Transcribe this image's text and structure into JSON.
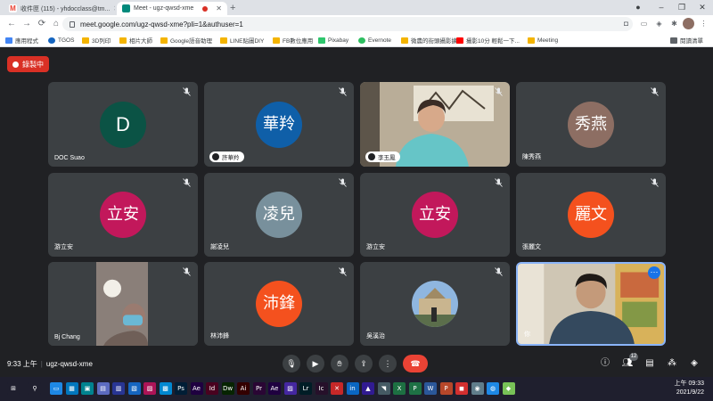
{
  "browser": {
    "tabs": [
      {
        "title": "收件匣 (115) - yhdocclass@tm...",
        "favicon_color": "#ea4335",
        "favicon_text": "M"
      },
      {
        "title": "Meet - ugz-qwsd-xme",
        "favicon_color": "#00897b",
        "favicon_text": ""
      }
    ],
    "url": "meet.google.com/ugz-qwsd-xme?pli=1&authuser=1",
    "bookmarks": [
      {
        "label": "應用程式",
        "icon_color": "#4285f4"
      },
      {
        "label": "TGOS",
        "icon_color": "#1565c0"
      },
      {
        "label": "3D列印",
        "icon_color": "#f4b400"
      },
      {
        "label": "相片大師",
        "icon_color": "#f4b400"
      },
      {
        "label": "Google語音助理",
        "icon_color": "#f4b400"
      },
      {
        "label": "LINE貼圖DIY",
        "icon_color": "#f4b400"
      },
      {
        "label": "FB數位應用",
        "icon_color": "#f4b400"
      },
      {
        "label": "Pixabay",
        "icon_color": "#2ec66d"
      },
      {
        "label": "Evernote",
        "icon_color": "#2dbe60"
      },
      {
        "label": "微農的街頭攝影擴",
        "icon_color": "#f4b400"
      },
      {
        "label": "攝影10分 輕鬆一下...",
        "icon_color": "#ff0000"
      },
      {
        "label": "Meeting",
        "icon_color": "#f4b400"
      }
    ],
    "reading_list": "閱讀清單"
  },
  "meet": {
    "recording_label": "錄製中",
    "meeting_time": "9:33 上午",
    "meeting_code": "ugz-qwsd-xme",
    "participant_count": "12",
    "tiles": [
      {
        "name": "DOC Suao",
        "avatar_text": "D",
        "avatar_color": "#0b5345",
        "kind": "avatar",
        "single": true
      },
      {
        "name": "許華羚",
        "avatar_text": "華羚",
        "avatar_color": "#0f5fa8",
        "kind": "avatar",
        "pill": true
      },
      {
        "name": "李玉鳳",
        "avatar_text": "",
        "avatar_color": "",
        "kind": "video-woman",
        "pill": true
      },
      {
        "name": "陳秀燕",
        "avatar_text": "秀燕",
        "avatar_color": "#8d6e63",
        "kind": "avatar"
      },
      {
        "name": "游立安",
        "avatar_text": "立安",
        "avatar_color": "#c2185b",
        "kind": "avatar"
      },
      {
        "name": "謝凌兒",
        "avatar_text": "凌兒",
        "avatar_color": "#78909c",
        "kind": "avatar"
      },
      {
        "name": "游立安",
        "avatar_text": "立安",
        "avatar_color": "#c2185b",
        "kind": "avatar"
      },
      {
        "name": "張麗文",
        "avatar_text": "麗文",
        "avatar_color": "#f4511e",
        "kind": "avatar"
      },
      {
        "name": "Bj Chang",
        "avatar_text": "",
        "avatar_color": "",
        "kind": "video-dark"
      },
      {
        "name": "林沛鋒",
        "avatar_text": "沛鋒",
        "avatar_color": "#f4511e",
        "kind": "avatar"
      },
      {
        "name": "吳溪治",
        "avatar_text": "",
        "avatar_color": "",
        "kind": "photo-avatar"
      },
      {
        "name": "你",
        "avatar_text": "",
        "avatar_color": "",
        "kind": "video-man"
      }
    ]
  },
  "taskbar": {
    "time": "上午 09:33",
    "date": "2021/9/22",
    "apps": [
      {
        "label": "⊞",
        "color": "#1f1f2e"
      },
      {
        "label": "⚲",
        "color": "#1f1f2e"
      },
      {
        "label": "▭",
        "color": "#1e88e5"
      },
      {
        "label": "▦",
        "color": "#0277bd"
      },
      {
        "label": "▣",
        "color": "#00838f"
      },
      {
        "label": "▤",
        "color": "#5c6bc0"
      },
      {
        "label": "▥",
        "color": "#283593"
      },
      {
        "label": "▧",
        "color": "#1565c0"
      },
      {
        "label": "▨",
        "color": "#ad1457"
      },
      {
        "label": "▩",
        "color": "#0288d1"
      },
      {
        "label": "Ps",
        "color": "#001e36"
      },
      {
        "label": "Ae",
        "color": "#1f0040"
      },
      {
        "label": "Id",
        "color": "#49021f"
      },
      {
        "label": "Dw",
        "color": "#072401"
      },
      {
        "label": "Ai",
        "color": "#330000"
      },
      {
        "label": "Pr",
        "color": "#2a0634"
      },
      {
        "label": "Ae",
        "color": "#1f0040"
      },
      {
        "label": "▨",
        "color": "#4527a0"
      },
      {
        "label": "Lr",
        "color": "#001d26"
      },
      {
        "label": "Ic",
        "color": "#26102a"
      },
      {
        "label": "✕",
        "color": "#c62828"
      },
      {
        "label": "in",
        "color": "#0a66c2"
      },
      {
        "label": "▲",
        "color": "#311b92"
      },
      {
        "label": "◥",
        "color": "#455a64"
      },
      {
        "label": "X",
        "color": "#1d6f42"
      },
      {
        "label": "P",
        "color": "#1e7145"
      },
      {
        "label": "W",
        "color": "#2b579a"
      },
      {
        "label": "P",
        "color": "#b7472a"
      },
      {
        "label": "◼",
        "color": "#d32f2f"
      },
      {
        "label": "◉",
        "color": "#607d8b"
      },
      {
        "label": "◍",
        "color": "#1e88e5"
      },
      {
        "label": "◆",
        "color": "#78c257"
      }
    ]
  }
}
